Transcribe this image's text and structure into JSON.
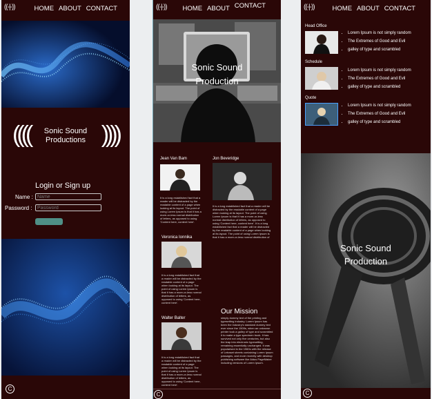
{
  "nav": {
    "logo_glyph": "((-|-))",
    "links": [
      "HOME",
      "ABOUT",
      "CONTACT"
    ]
  },
  "panel1": {
    "brand": {
      "rings_left": "((((",
      "rings_right": "))))",
      "line1": "Sonic Sound",
      "line2": "Productions"
    },
    "login": {
      "title": "Login or Sign up",
      "name_label": "Name :",
      "name_placeholder": "Name",
      "password_label": "Password :",
      "password_placeholder": "Password"
    },
    "footer_icon": "C"
  },
  "panel2": {
    "hero": {
      "line1": "Sonic Sound",
      "line2": "Production"
    },
    "team": [
      {
        "name": "Jean Van Bam",
        "text": "It is a long established fact that a reader will be distracted by the readable content of a page when looking at its layout. The point of using Lorem Ipsum is that it has a more-or-less normal distribution of letters, as opposed to using 'Content here, content here'."
      },
      {
        "name": "Jon Beveridge",
        "text": "It is a long established fact that a reader will be distracted by the readable content of a page when looking at its layout. The point of using Lorem Ipsum is that it has a more-or-less normal distribution of letters, as opposed to using 'Content here, content here'. It is a long established fact that a reader will be distracted by the readable content of a page when looking at its layout. The point of using Lorem Ipsum is that it has a more-or-less normal distribution of letters, as opposed to using 'Content here, content here'."
      },
      {
        "name": "Veronica Ionnika",
        "text": "It is a long established fact that a reader will be distracted by the readable content of a page when looking at its layout. The point of using Lorem Ipsum is that it has a more-or-less normal distribution of letters, as opposed to using 'Content here, content here'."
      },
      {
        "name": "Walter Balter",
        "text": "It is a long established fact that a reader will be distracted by the readable content of a page when looking at its layout. The point of using Lorem Ipsum is that it has a more-or-less normal distribution of letters, as opposed to using 'Content here, content here'."
      }
    ],
    "mission": {
      "title": "Our Mission",
      "text": "simply dummy text of the printing and typesetting industry. Lorem Ipsum has been the industry's standard dummy text ever since the 1500s, when an unknown printer took a galley of type and scrambled it to make a type specimen book. It has survived not only five centuries, but also the leap into electronic typesetting, remaining essentially unchanged. It was popularised in the 1960s with the release of Letraset sheets containing Lorem Ipsum passages, and more recently with desktop publishing software like Aldus PageMaker including versions of Lorem Ipsum."
    },
    "footer_icon": "C"
  },
  "panel3": {
    "sections": [
      {
        "title": "Head Office",
        "items": [
          "Lorem Ipsum is not simply random",
          "The Extremes of Good and Evil",
          "galley of type and scrambled"
        ]
      },
      {
        "title": "Schedule",
        "items": [
          "Lorem Ipsum is not simply random",
          "The Extremes of Good and Evil",
          "galley of type and scrambled"
        ]
      },
      {
        "title": "Quote",
        "items": [
          "Lorem Ipsum is not simply random",
          "The Extremes of Good and Evil",
          "galley of type and scrambled"
        ]
      }
    ],
    "hero": {
      "line1": "Sonic Sound",
      "line2": "Production"
    },
    "footer_icon": "C"
  },
  "colors": {
    "background": "#2a0707",
    "accent": "#4f8f86",
    "page": "#eceef0",
    "link_outline": "#6fa4b4"
  }
}
